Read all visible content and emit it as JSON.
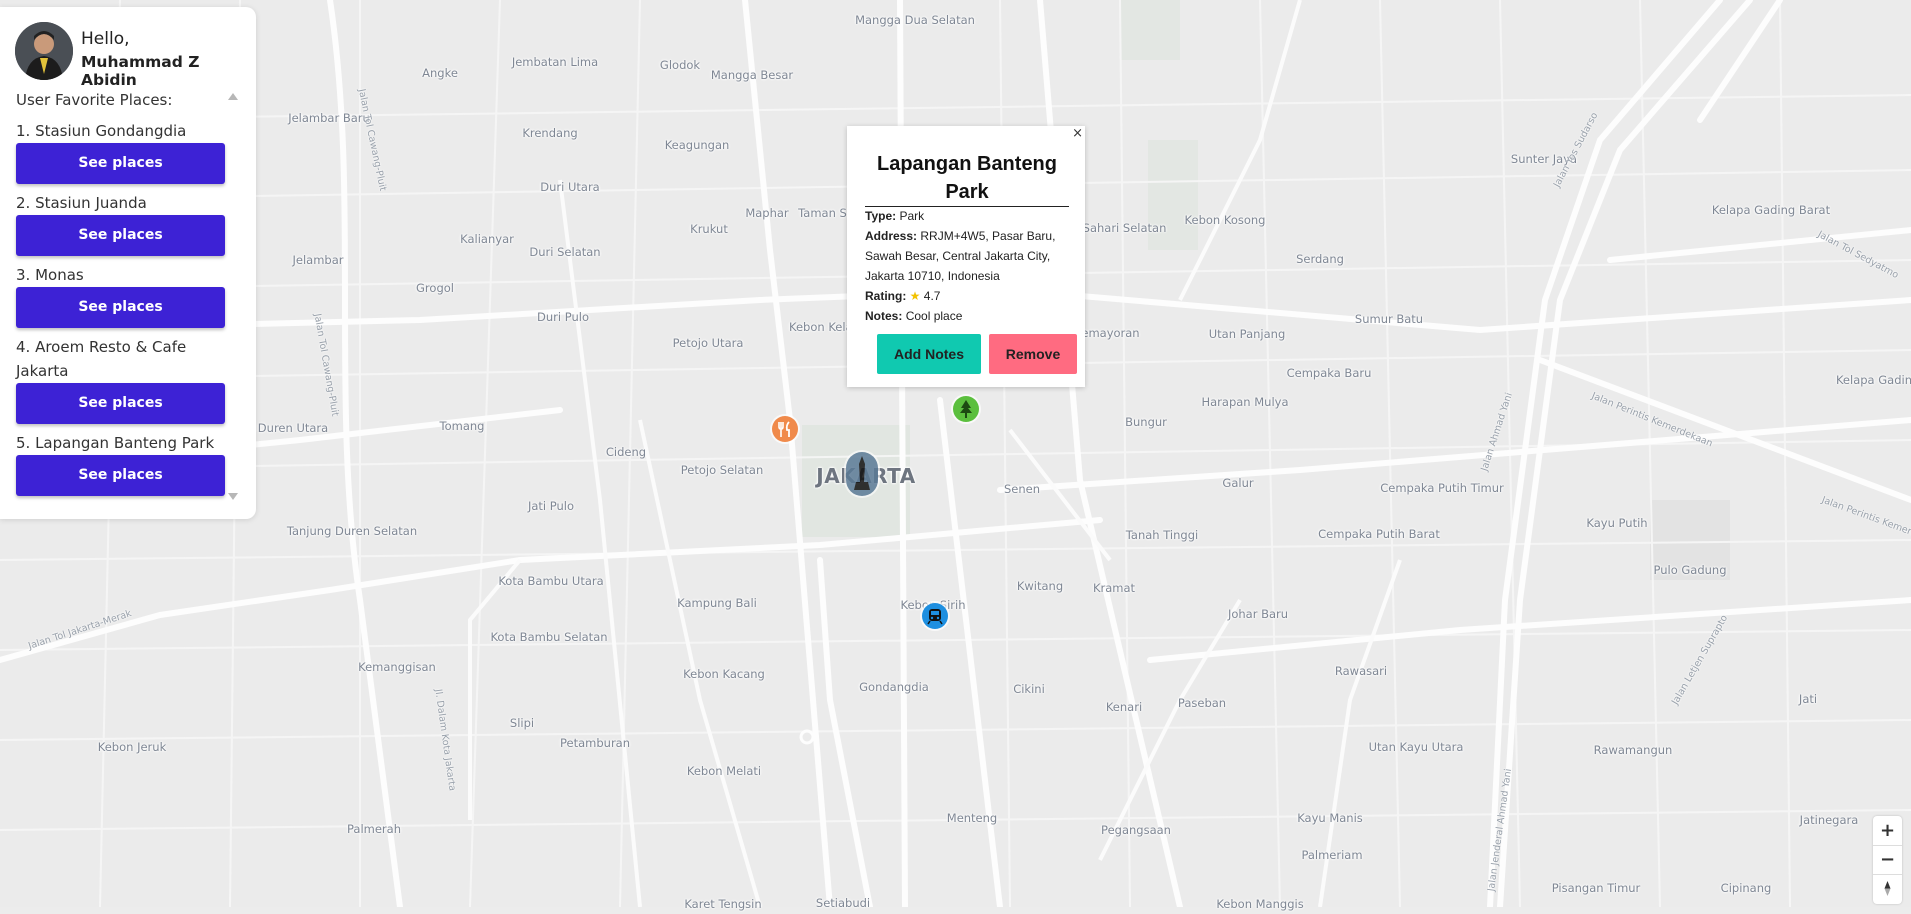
{
  "user": {
    "greeting": "Hello,",
    "name": "Muhammad Z Abidin"
  },
  "favorites": {
    "heading": "User Favorite Places:",
    "button_label": "See places",
    "items": [
      {
        "label": "1. Stasiun Gondangdia"
      },
      {
        "label": "2. Stasiun Juanda"
      },
      {
        "label": "3. Monas"
      },
      {
        "label": "4. Aroem Resto & Cafe Jakarta"
      },
      {
        "label": "5. Lapangan Banteng Park"
      }
    ]
  },
  "popup": {
    "close": "×",
    "title": "Lapangan Banteng Park",
    "type_label": "Type:",
    "type": "Park",
    "address_label": "Address:",
    "address": "RRJM+4W5, Pasar Baru, Sawah Besar, Central Jakarta City, Jakarta 10710, Indonesia",
    "rating_label": "Rating:",
    "rating": "4.7",
    "notes_label": "Notes:",
    "notes": "Cool place",
    "add_notes_label": "Add Notes",
    "remove_label": "Remove"
  },
  "markers": [
    {
      "name": "restaurant",
      "icon": "fork-knife-icon",
      "color": "#f08a4b"
    },
    {
      "name": "park",
      "icon": "tree-icon",
      "color": "#5bbf3e"
    },
    {
      "name": "monument",
      "icon": "monument-icon",
      "color": "#5b7a96"
    },
    {
      "name": "train-station",
      "icon": "train-icon",
      "color": "#1e8fe0"
    }
  ],
  "map": {
    "city_label": "JAKARTA",
    "area_labels": [
      "Mangga Dua Selatan",
      "Jembatan Lima",
      "Glodok",
      "Angke",
      "Mangga Besar",
      "Jelambar Baru",
      "Krendang",
      "Keagungan",
      "Duri Utara",
      "Kalianyar",
      "Krukut",
      "Maphar",
      "Taman Sari",
      "Jelambar",
      "Duri Selatan",
      "Grogol",
      "Duri Pulo",
      "Petojo Utara",
      "Kebon Kelapa",
      "Duren Utara",
      "Tomang",
      "Cideng",
      "Petojo Selatan",
      "Jati Pulo",
      "Tanjung Duren Selatan",
      "Kota Bambu Utara",
      "Kota Bambu Selatan",
      "Kampung Bali",
      "Kemanggisan",
      "Kebon Kacang",
      "Slipi",
      "Gondangdia",
      "Cikini",
      "Petamburan",
      "Kebon Melati",
      "Kebon Jeruk",
      "Palmerah",
      "Menteng",
      "Senen",
      "Bungur",
      "Kwitang",
      "Kramat",
      "Tanah Tinggi",
      "Galur",
      "Johar Baru",
      "Kenari",
      "Paseban",
      "Rawasari",
      "Utan Kayu Utara",
      "Kayu Manis",
      "Pegangsaan",
      "Palmeriam",
      "Kebon Kosong",
      "Serdang",
      "Gunung Sahari Selatan",
      "Kemayoran",
      "Utan Panjang",
      "Cempaka Baru",
      "Harapan Mulya",
      "Sumur Batu",
      "Sunter Jaya",
      "Kelapa Gading Barat",
      "Kelapa Gading Tim",
      "Cempaka Putih Timur",
      "Cempaka Putih Barat",
      "Kayu Putih",
      "Pulo Gadung",
      "Jati",
      "Rawamangun",
      "Jatinegara",
      "Cipinang",
      "Pisangan Timur",
      "Kebon Manggis",
      "Karet Tengsin",
      "Setiabudi",
      "Kebon Sirih"
    ],
    "road_labels": [
      "Jalan Tol Cawang-Pluit",
      "Jalan Tol Cawang-Pluit",
      "Jalan Tol Jakarta-Merak",
      "Jl. Dalam Kota Jakarta",
      "Jalan Yos Sudarso",
      "Jalan Tol Sedyatmo",
      "Jalan Ahmad Yani",
      "Jalan Perintis Kemerdekaan",
      "Jalan Perintis Kemerde",
      "Jalan Jenderal Ahmad Yani",
      "Jalan Letjen Suprapto"
    ]
  }
}
